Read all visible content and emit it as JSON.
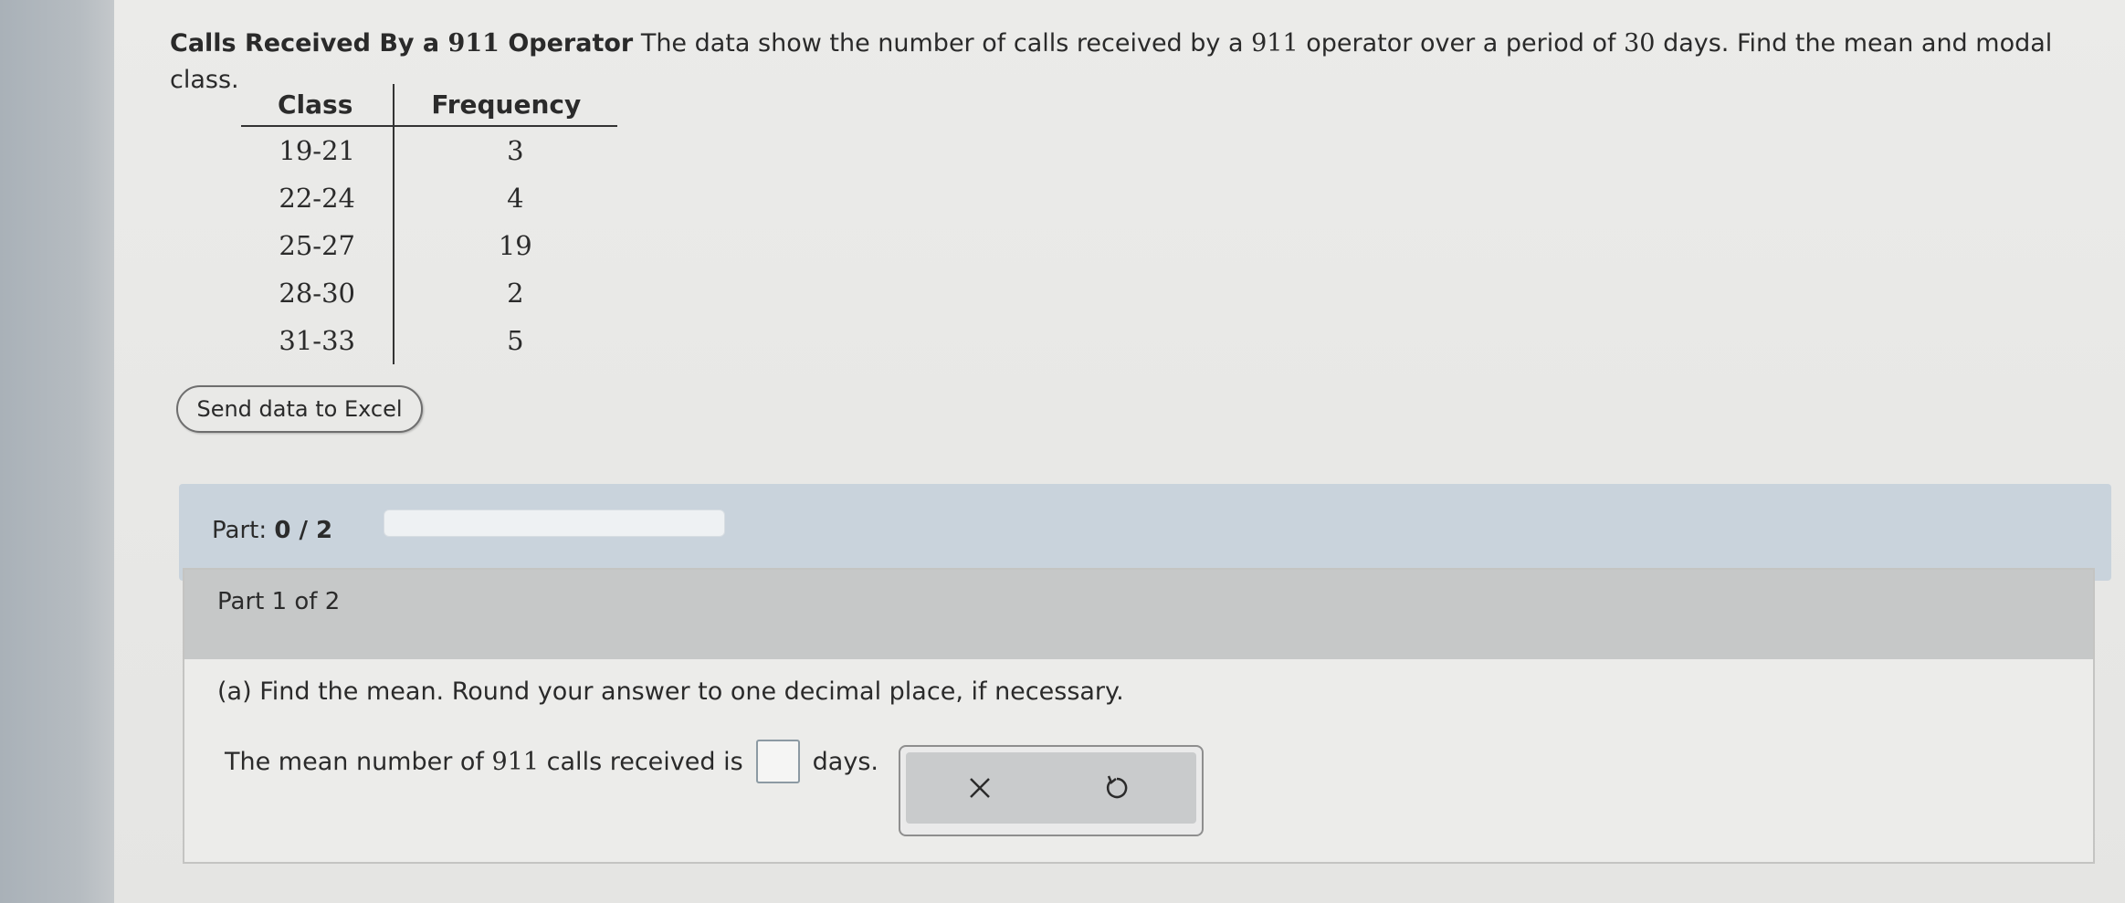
{
  "problem": {
    "title": "Calls Received By a",
    "title_number": "911",
    "title_end": "Operator",
    "text_a": "The data show the number of calls received by a",
    "text_num": "911",
    "text_b": "operator over a period of",
    "days_num": "30",
    "text_c": "days. Find the mean and modal class."
  },
  "table": {
    "headers": [
      "Class",
      "Frequency"
    ],
    "rows": [
      {
        "class": "19-21",
        "frequency": "3"
      },
      {
        "class": "22-24",
        "frequency": "4"
      },
      {
        "class": "25-27",
        "frequency": "19"
      },
      {
        "class": "28-30",
        "frequency": "2"
      },
      {
        "class": "31-33",
        "frequency": "5"
      }
    ]
  },
  "send_excel_label": "Send data to Excel",
  "part_progress": {
    "prefix": "Part:",
    "value": "0 / 2",
    "fraction": 0.0
  },
  "part_card": {
    "header": "Part 1 of 2",
    "question": "(a) Find the mean. Round your answer to one decimal place, if necessary.",
    "answer_prefix": "The mean number of",
    "answer_num": "911",
    "answer_mid": "calls received is",
    "answer_suffix": "days.",
    "answer_value": ""
  },
  "icons": {
    "clear": "close-icon",
    "undo": "undo-icon"
  }
}
